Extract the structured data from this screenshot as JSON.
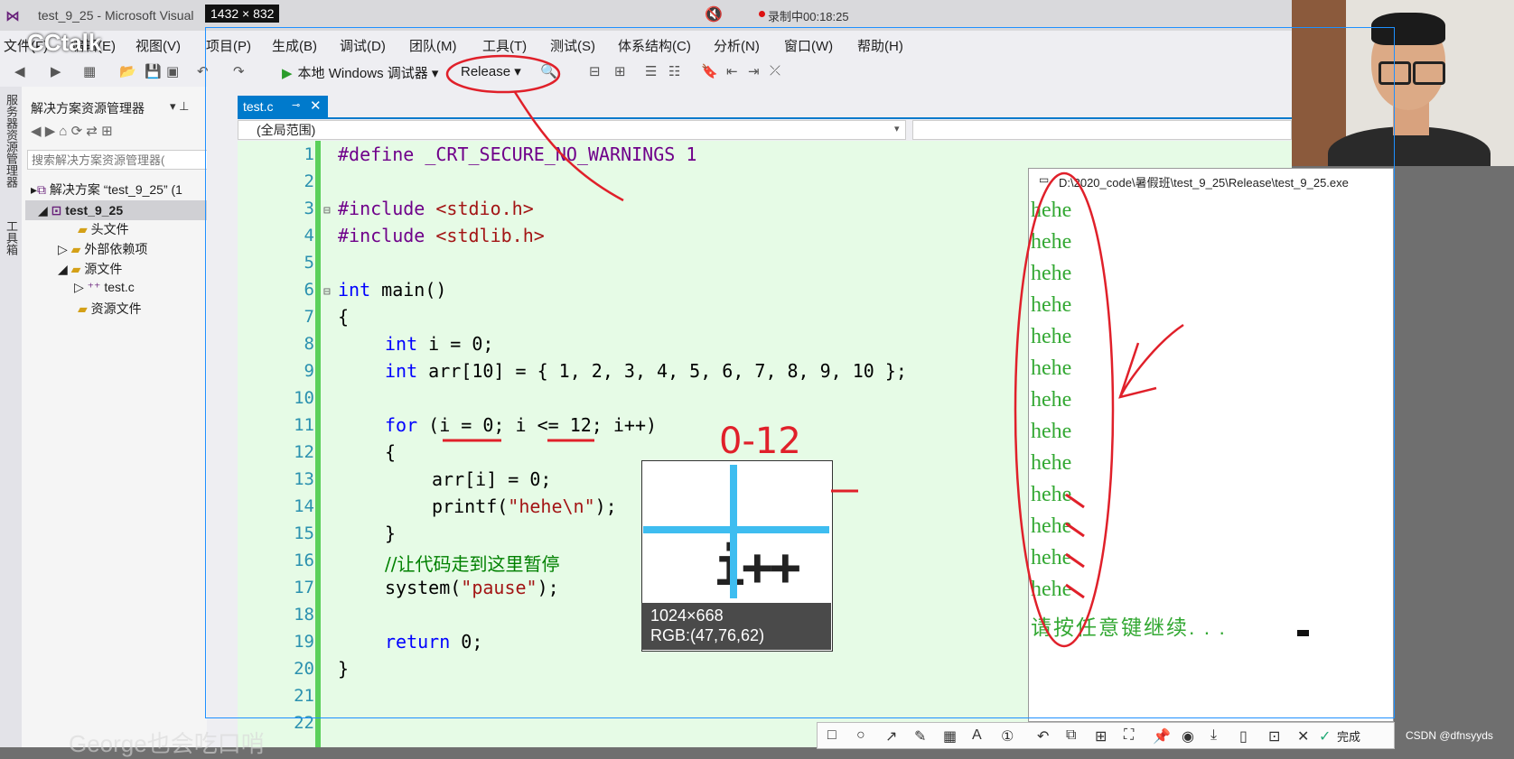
{
  "window": {
    "title": "test_9_25 - Microsoft Visual",
    "selection_size": "1432 × 832",
    "recording_status": "录制中00:18:25",
    "brand_overlay": "CCtalk"
  },
  "menu": [
    "文件(F)",
    "编辑(E)",
    "视图(V)",
    "项目(P)",
    "生成(B)",
    "调试(D)",
    "团队(M)",
    "工具(T)",
    "测试(S)",
    "体系结构(C)",
    "分析(N)",
    "窗口(W)",
    "帮助(H)"
  ],
  "toolbar": {
    "debugger_label": "本地 Windows 调试器",
    "configuration": "Release"
  },
  "side_strip": [
    "服务器资源管理器",
    "工具箱"
  ],
  "solution_explorer": {
    "title": "解决方案资源管理器",
    "search_placeholder": "搜索解决方案资源管理器(",
    "solution": "解决方案 “test_9_25” (1",
    "project": "test_9_25",
    "items": [
      "头文件",
      "外部依赖项",
      "源文件",
      "test.c",
      "资源文件"
    ]
  },
  "editor": {
    "tab_name": "test.c",
    "scope": "(全局范围)",
    "line_numbers": [
      "1",
      "2",
      "3",
      "4",
      "5",
      "6",
      "7",
      "8",
      "9",
      "10",
      "11",
      "12",
      "13",
      "14",
      "15",
      "16",
      "17",
      "18",
      "19",
      "20",
      "21",
      "22"
    ],
    "code": {
      "l1_kw": "#define",
      "l1_rest": " _CRT_SECURE_NO_WARNINGS 1",
      "l3_kw": "#include",
      "l3_rest": " <stdio.h>",
      "l4_kw": "#include",
      "l4_rest": " <stdlib.h>",
      "l6_kw": "int",
      "l6_rest": " main()",
      "l7": "{",
      "l8_kw": "int",
      "l8_rest": " i = 0;",
      "l9_kw": "int",
      "l9_rest": " arr[10] = { 1, 2, 3, 4, 5, 6, 7, 8, 9, 10 };",
      "l11_kw": "for",
      "l11_rest": " (i = 0; i <= 12; i++)",
      "l12": "{",
      "l13": "arr[i] = 0;",
      "l14_a": "printf(",
      "l14_str": "\"hehe\\n\"",
      "l14_b": ");",
      "l15": "}",
      "l16": "//让代码走到这里暂停",
      "l17_a": "system(",
      "l17_str": "\"pause\"",
      "l17_b": ");",
      "l19_kw": "return",
      "l19_rest": " 0;",
      "l20": "}"
    }
  },
  "console": {
    "title": "D:\\2020_code\\暑假班\\test_9_25\\Release\\test_9_25.exe",
    "lines": [
      "hehe",
      "hehe",
      "hehe",
      "hehe",
      "hehe",
      "hehe",
      "hehe",
      "hehe",
      "hehe",
      "hehe",
      "hehe",
      "hehe",
      "hehe"
    ],
    "prompt": "请按任意键继续. . ."
  },
  "magnifier": {
    "zoom_text": "i++",
    "coords": "1024×668",
    "rgb": "RGB:(47,76,62)"
  },
  "annotation": {
    "range_text": "0-12"
  },
  "snip_toolbar": {
    "done_label": "完成"
  },
  "overlay": {
    "subtitle": "George也会吃口哨",
    "watermark": "CSDN @dfnsyyds"
  },
  "colors": {
    "editor_bg": "#e6fbe6",
    "console_text": "#33a833",
    "tab_blue": "#007acc",
    "ink_red": "#e0202a",
    "magnifier_cross": "#3ebdf0"
  }
}
